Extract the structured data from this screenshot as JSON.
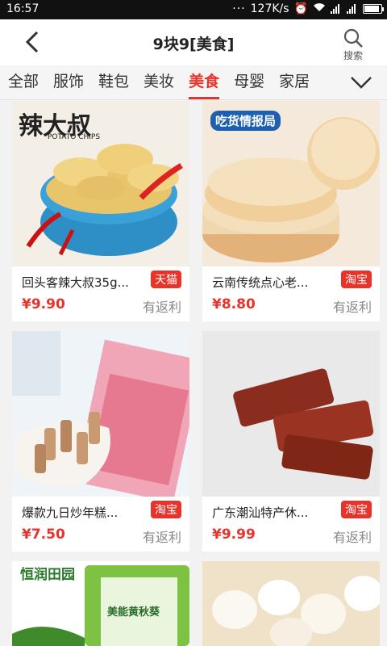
{
  "status": {
    "time": "16:57",
    "speed": "127K/s"
  },
  "header": {
    "title": "9块9[美食]",
    "search_label": "搜索"
  },
  "tabs": [
    {
      "label": "全部",
      "active": false
    },
    {
      "label": "服饰",
      "active": false
    },
    {
      "label": "鞋包",
      "active": false
    },
    {
      "label": "美妆",
      "active": false
    },
    {
      "label": "美食",
      "active": true
    },
    {
      "label": "母婴",
      "active": false
    },
    {
      "label": "家居",
      "active": false
    }
  ],
  "products": [
    {
      "name": "回头客辣大叔35g...",
      "badge": "天猫",
      "price": "¥9.90",
      "rebate": "有返利",
      "image_text": "辣大叔",
      "image_subtext": "POTATO CHIPS"
    },
    {
      "name": "云南传统点心老...",
      "badge": "淘宝",
      "price": "¥8.80",
      "rebate": "有返利",
      "image_text": "吃货情报局"
    },
    {
      "name": "爆款九日炒年糕...",
      "badge": "淘宝",
      "price": "¥7.50",
      "rebate": "有返利"
    },
    {
      "name": "广东潮汕特产休...",
      "badge": "淘宝",
      "price": "¥9.99",
      "rebate": "有返利"
    },
    {
      "name": "",
      "badge": "",
      "price": "",
      "rebate": "",
      "image_text": "恒润田园",
      "image_subtext": "美能黄秋葵"
    },
    {
      "name": "",
      "badge": "",
      "price": "",
      "rebate": ""
    }
  ],
  "colors": {
    "accent": "#e8332b"
  }
}
